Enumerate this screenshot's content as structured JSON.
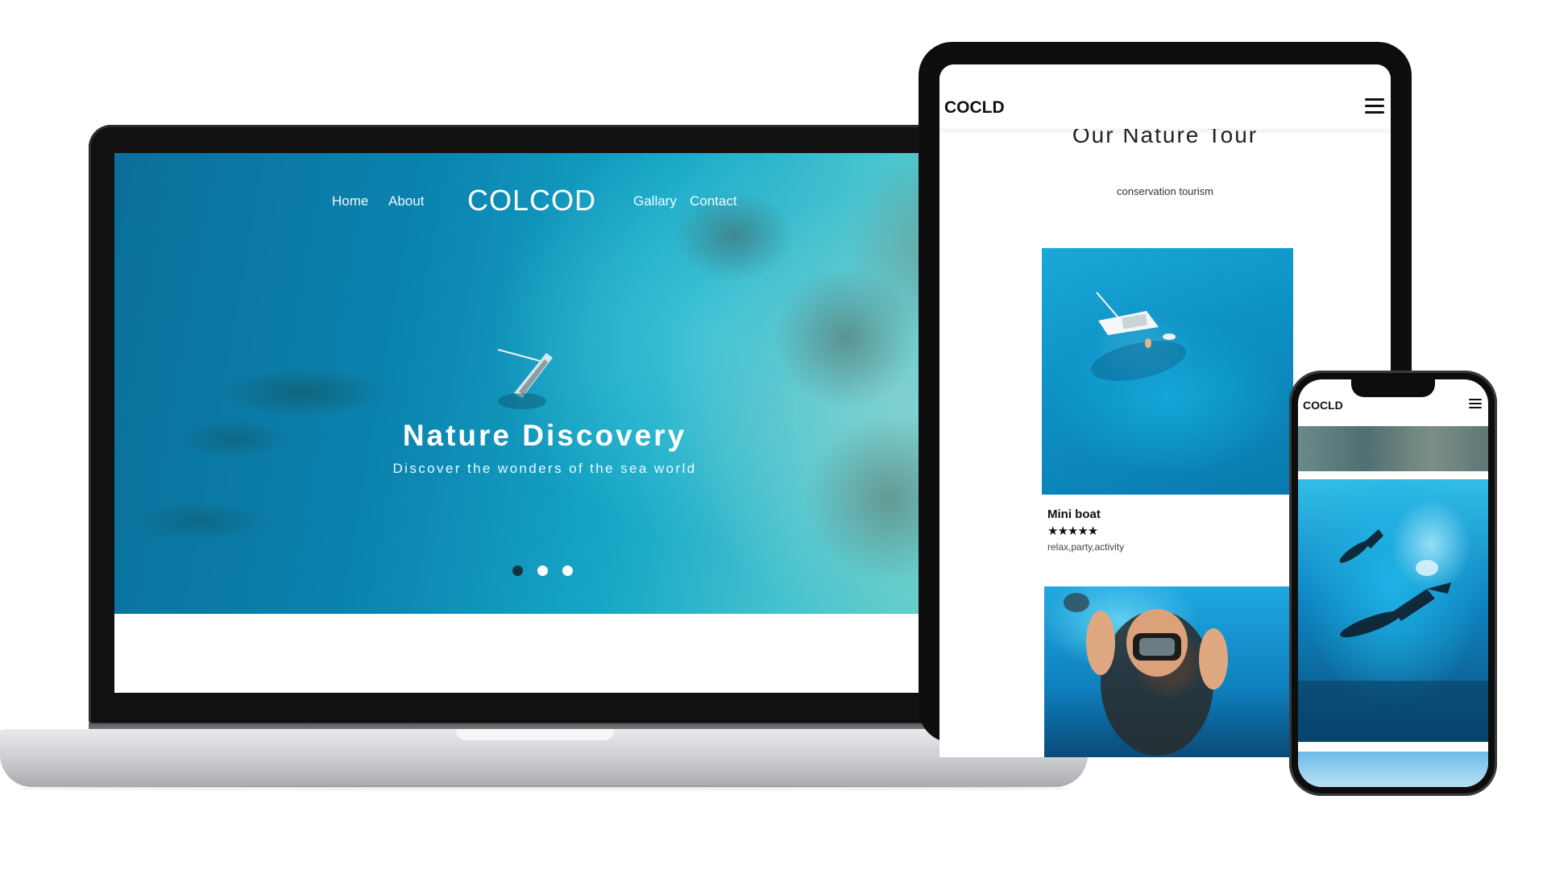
{
  "laptop": {
    "nav": {
      "home": "Home",
      "about": "About",
      "logo": "COLCOD",
      "gallery": "Gallary",
      "contact": "Contact"
    },
    "hero": {
      "title": "Nature Discovery",
      "subtitle": "Discover the wonders of the sea world",
      "slides_total": 3,
      "active_slide": 1
    }
  },
  "tablet": {
    "brand": "COCLD",
    "section_title": "Our Nature Tour",
    "section_subtitle": "conservation tourism",
    "card": {
      "title": "Mini boat",
      "rating": "★★★★★",
      "tags": "relax,party,activity"
    }
  },
  "phone": {
    "brand": "COCLD"
  },
  "colors": {
    "sea": "#0b84b0",
    "reef": "#6fd1c7",
    "device_frame": "#0e0e0e",
    "dot_active": "#14333f"
  },
  "icons": [
    "drop-icon",
    "hamburger-icon",
    "boat-icon",
    "diver-icon"
  ]
}
